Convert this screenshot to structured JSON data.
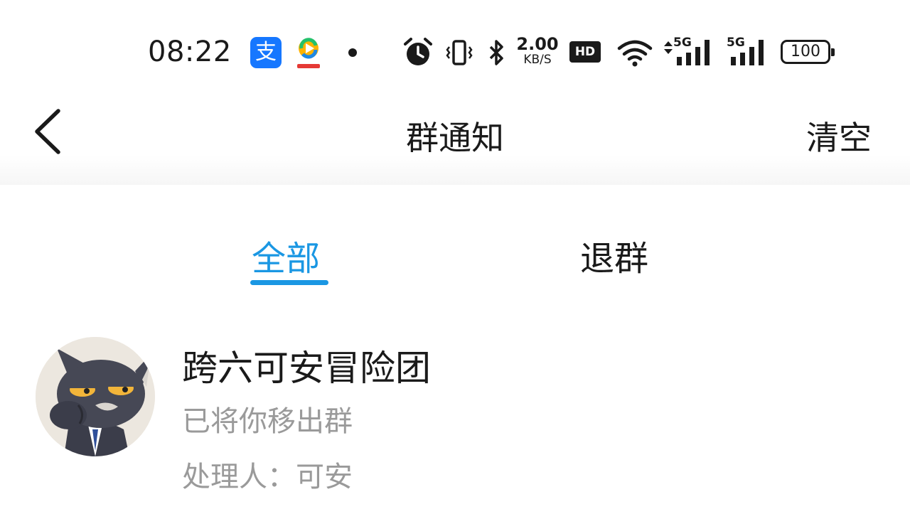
{
  "status_bar": {
    "time": "08:22",
    "alipay_icon_glyph": "支",
    "net_speed_value": "2.00",
    "net_speed_unit": "KB/S",
    "hd_badge": "HD",
    "sim1_label": "5G",
    "sim2_label": "5G",
    "battery_level": "100",
    "icons": [
      "alipay-icon",
      "video-app-icon",
      "notification-dot",
      "alarm-icon",
      "vibrate-icon",
      "bluetooth-icon",
      "hd-icon",
      "wifi-icon",
      "signal-icon",
      "signal-icon",
      "battery-icon"
    ]
  },
  "nav": {
    "back_icon": "chevron-left-icon",
    "title": "群通知",
    "clear_label": "清空"
  },
  "tabs": [
    {
      "label": "全部",
      "selected": true
    },
    {
      "label": "退群",
      "selected": false
    }
  ],
  "accent_color": "#1a97e3",
  "notices": [
    {
      "group_name": "跨六可安冒险团",
      "message": "已将你移出群",
      "handler_label": "处理人：",
      "handler_name": "可安",
      "avatar": "cartoon-cat-avatar"
    }
  ]
}
